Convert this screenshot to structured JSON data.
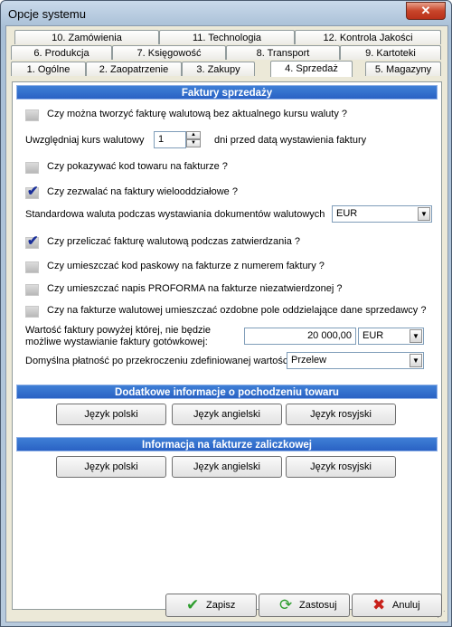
{
  "window": {
    "title": "Opcje systemu",
    "close_symbol": "✕"
  },
  "tabs": {
    "row1": [
      "10. Zamówienia",
      "11. Technologia",
      "12. Kontrola Jakości"
    ],
    "row2": [
      "6. Produkcja",
      "7. Księgowość",
      "8. Transport",
      "9. Kartoteki"
    ],
    "row3": [
      "1. Ogólne",
      "2. Zaopatrzenie",
      "3. Zakupy",
      "4. Sprzedaż",
      "5. Magazyny"
    ],
    "active": "4. Sprzedaż"
  },
  "sales": {
    "header": "Faktury sprzedaży",
    "opt_no_rate": {
      "label": "Czy można tworzyć fakturę walutową bez aktualnego kursu waluty ?",
      "checked": false
    },
    "rate_days": {
      "prefix": "Uwzględniaj kurs walutowy",
      "value": "1",
      "suffix": "dni przed datą wystawienia faktury"
    },
    "opt_show_code": {
      "label": "Czy pokazywać kod towaru na fakturze ?",
      "checked": false
    },
    "opt_multi_branch": {
      "label": "Czy zezwalać na faktury wielooddziałowe ?",
      "checked": true
    },
    "default_currency": {
      "label": "Standardowa waluta podczas wystawiania dokumentów walutowych",
      "value": "EUR"
    },
    "opt_recalc": {
      "label": "Czy przeliczać fakturę walutową podczas zatwierdzania ?",
      "checked": true
    },
    "opt_barcode": {
      "label": "Czy umieszczać kod paskowy na fakturze z numerem faktury ?",
      "checked": false
    },
    "opt_proforma": {
      "label": "Czy umieszczać napis PROFORMA na fakturze niezatwierdzonej ?",
      "checked": false
    },
    "opt_separator": {
      "label": "Czy na fakturze walutowej umieszczać ozdobne pole oddzielające dane sprzedawcy ?",
      "checked": false
    },
    "cash_limit": {
      "label_line1": "Wartość faktury powyżej której, nie będzie",
      "label_line2": "możliwe wystawianie faktury gotówkowej:",
      "value": "20 000,00",
      "currency": "EUR"
    },
    "default_payment": {
      "label": "Domyślna płatność po przekroczeniu zdefiniowanej wartości:",
      "value": "Przelew"
    }
  },
  "origin": {
    "header": "Dodatkowe informacje o pochodzeniu towaru",
    "buttons": [
      "Język polski",
      "Język angielski",
      "Język rosyjski"
    ]
  },
  "advance": {
    "header": "Informacja na fakturze zaliczkowej",
    "buttons": [
      "Język polski",
      "Język angielski",
      "Język rosyjski"
    ]
  },
  "footer": {
    "ok": "Zapisz",
    "apply": "Zastosuj",
    "cancel": "Anuluj"
  },
  "check_glyph": "✔",
  "arrow_glyph": "▼",
  "colors": {
    "section": "#2a62c4",
    "check": "#1a2f9a",
    "ok_icon": "#2e9d2e",
    "cancel_icon": "#c8201a"
  }
}
